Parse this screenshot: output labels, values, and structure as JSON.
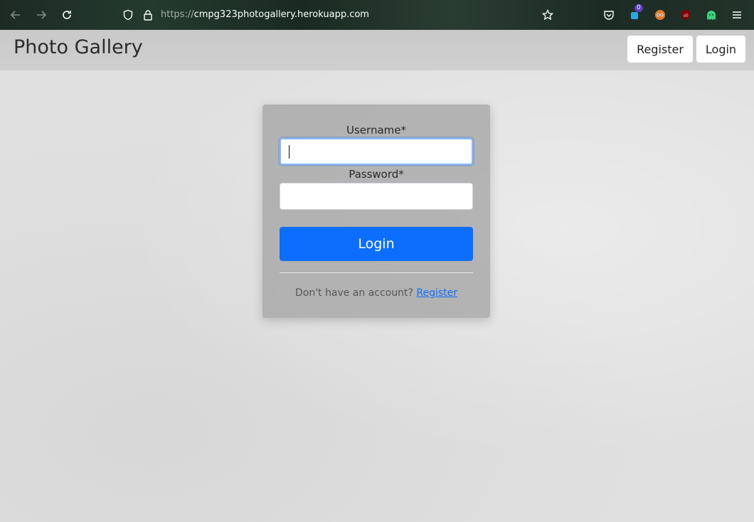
{
  "browser": {
    "url_protocol": "https://",
    "url_host": "cmpg323photogallery.herokuapp.com",
    "extension_badge_count": "0",
    "icons": [
      "back-arrow-icon",
      "forward-arrow-icon",
      "reload-icon",
      "shield-icon",
      "lock-icon",
      "bookmark-star-icon",
      "pocket-icon",
      "extension-icon",
      "privacy-badger-icon",
      "ublock-icon",
      "ghostery-icon",
      "hamburger-menu-icon"
    ]
  },
  "header": {
    "title": "Photo Gallery",
    "register_label": "Register",
    "login_label": "Login"
  },
  "login_form": {
    "username_label": "Username*",
    "username_value": "",
    "password_label": "Password*",
    "password_value": "",
    "submit_label": "Login",
    "signup_prompt": "Don't have an account?",
    "signup_link": "Register"
  },
  "colors": {
    "primary": "#0d6efd",
    "header_bg": "#cbcbcb",
    "card_bg": "#a0a0a0"
  }
}
